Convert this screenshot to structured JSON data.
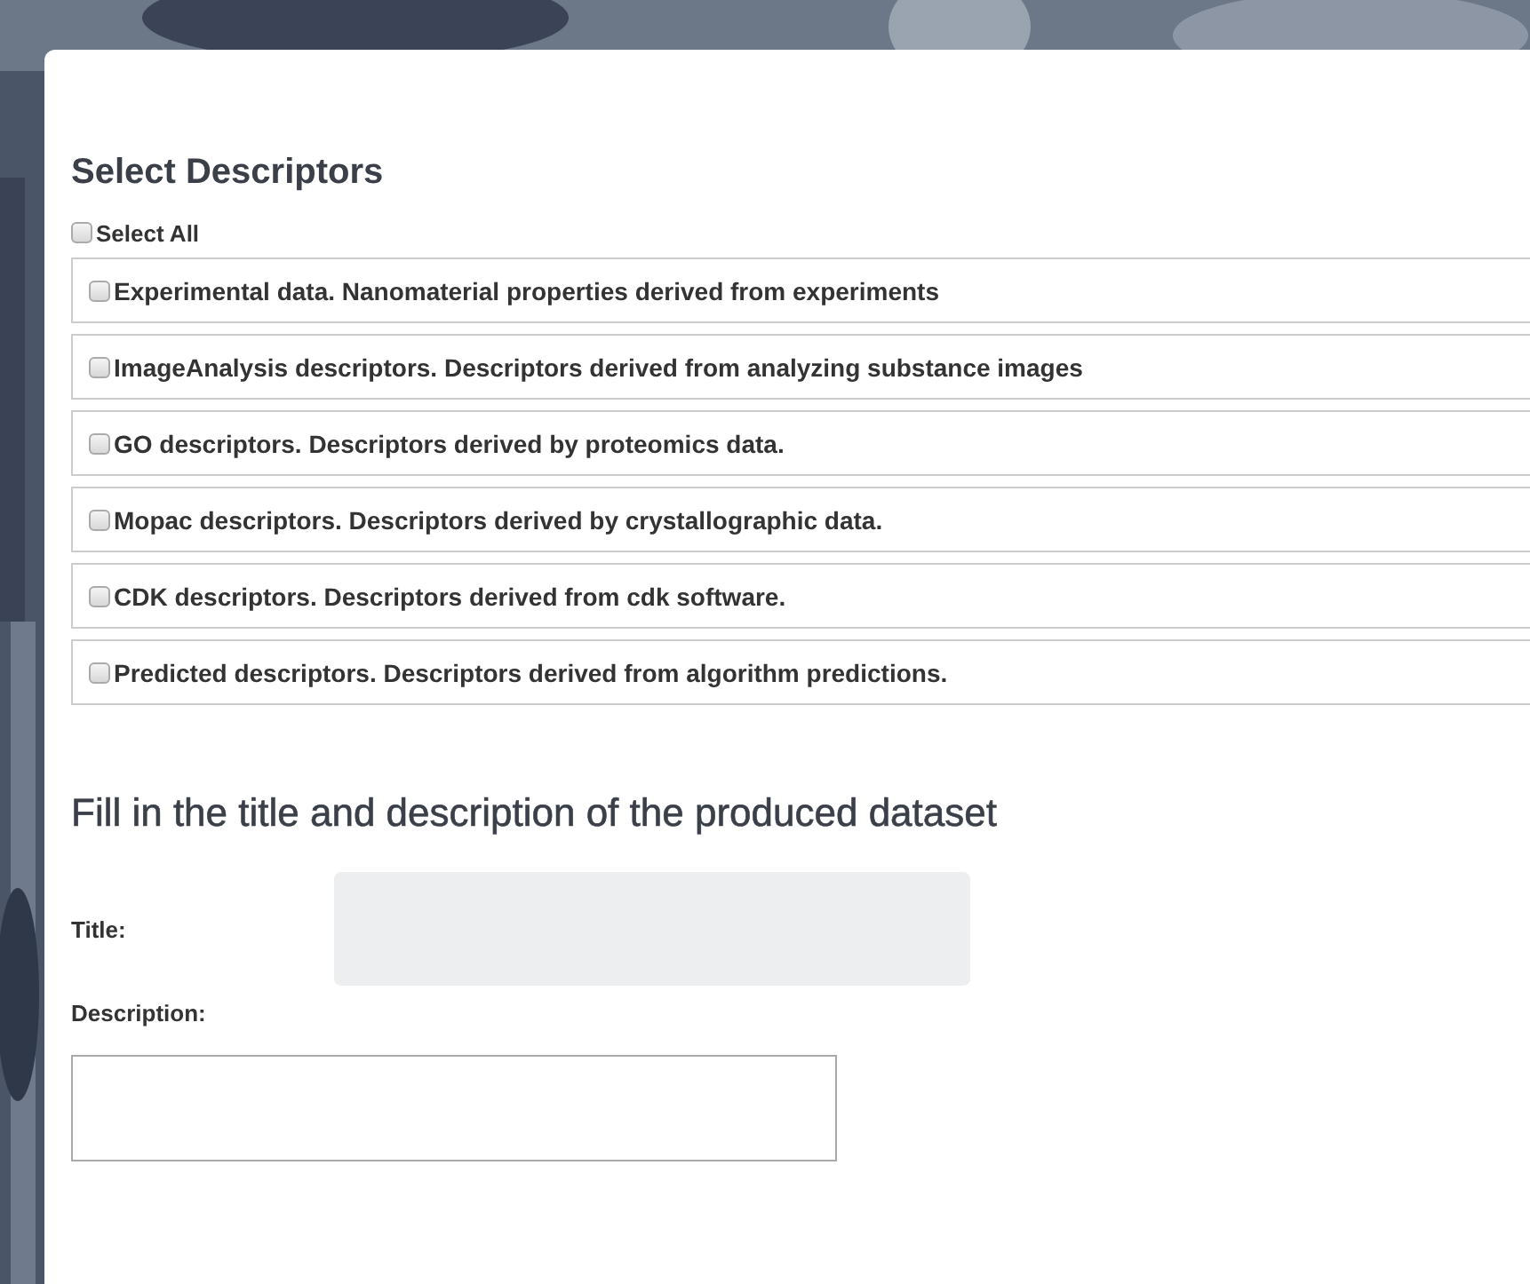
{
  "heading": "Select Descriptors",
  "select_all": {
    "label": "Select All",
    "checked": false
  },
  "descriptors": [
    {
      "label": "Experimental data. Nanomaterial properties derived from experiments",
      "checked": false
    },
    {
      "label": "ImageAnalysis descriptors. Descriptors derived from analyzing substance images",
      "checked": false
    },
    {
      "label": "GO descriptors. Descriptors derived by proteomics data.",
      "checked": false
    },
    {
      "label": "Mopac descriptors. Descriptors derived by crystallographic data.",
      "checked": false
    },
    {
      "label": "CDK descriptors. Descriptors derived from cdk software.",
      "checked": false
    },
    {
      "label": "Predicted descriptors. Descriptors derived from algorithm predictions.",
      "checked": false
    }
  ],
  "dataset_heading": "Fill in the title and description of the produced dataset",
  "fields": [
    {
      "label": "Title:",
      "kind": "input",
      "disabled": true
    },
    {
      "label": "Description:",
      "kind": "textarea",
      "disabled": false
    }
  ]
}
